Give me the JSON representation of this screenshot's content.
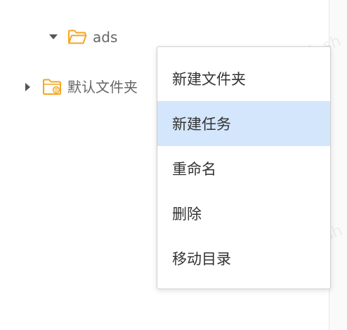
{
  "tree": {
    "nodes": [
      {
        "label": "ads",
        "expanded": true,
        "icon": "folder-open-icon"
      },
      {
        "label": "默认文件夹",
        "expanded": false,
        "icon": "folder-shared-icon"
      }
    ]
  },
  "context_menu": {
    "items": [
      {
        "label": "新建文件夹"
      },
      {
        "label": "新建任务",
        "highlighted": true
      },
      {
        "label": "重命名"
      },
      {
        "label": "删除"
      },
      {
        "label": "移动目录"
      }
    ]
  },
  "watermark": {
    "top": "wb.sh",
    "bottom": "wb.sh"
  },
  "colors": {
    "folder": "#f5a623",
    "highlight": "#d4e6fb",
    "label": "#666666",
    "menu_text": "#333333"
  }
}
